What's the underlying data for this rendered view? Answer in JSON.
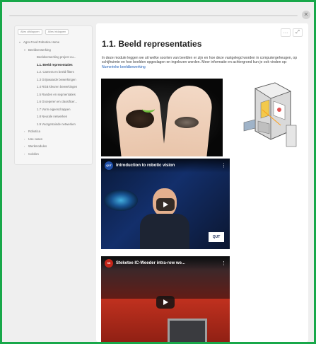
{
  "topbar": {
    "close_icon": "x-icon"
  },
  "sidebar": {
    "actions": [
      "Alles uitklappen",
      "Alles inklappen"
    ],
    "items": [
      {
        "label": "Agro-Food Robotica Home",
        "level": 0,
        "chevron": "▾"
      },
      {
        "label": "Beeldverwerking",
        "level": 1,
        "chevron": "▾"
      },
      {
        "label": "Beeldverwerking project ou...",
        "level": 2,
        "chevron": ""
      },
      {
        "label": "1.1. Beeld representaties",
        "level": 2,
        "chevron": "",
        "active": true
      },
      {
        "label": "1.2. Camera en beeld filters",
        "level": 2,
        "chevron": ""
      },
      {
        "label": "1.3 Grijswaarde bewerkingen",
        "level": 2,
        "chevron": ""
      },
      {
        "label": "1.4 RGB kleuren bewerkingen",
        "level": 2,
        "chevron": ""
      },
      {
        "label": "1.5 Randen en segmentaties",
        "level": 2,
        "chevron": ""
      },
      {
        "label": "1.6 Groeperen en classificer...",
        "level": 2,
        "chevron": ""
      },
      {
        "label": "1.7 Vorm eigenschappen",
        "level": 2,
        "chevron": ""
      },
      {
        "label": "1.8 Neurale netwerken",
        "level": 2,
        "chevron": ""
      },
      {
        "label": "1.9 Voorgetrainde netwerken",
        "level": 2,
        "chevron": ""
      },
      {
        "label": "Robotica",
        "level": 1,
        "chevron": "›"
      },
      {
        "label": "Use cases",
        "level": 1,
        "chevron": "›"
      },
      {
        "label": "Werkmodules",
        "level": 1,
        "chevron": "›"
      },
      {
        "label": "Colofon",
        "level": 1,
        "chevron": "›"
      }
    ]
  },
  "content": {
    "corner_buttons": [
      "…",
      "⤢"
    ],
    "title": "1.1. Beeld representaties",
    "intro_text": "In deze module leggen we uit welke soorten van beelden er zijn en hoe deze vastgelegd worden in computergeheugen, op schijfruimte en hoe beelden opgeslagen en ingelezen worden. Meer informatie en achtergrond kun je ook vinden op: ",
    "intro_link": "Numerieke beeldbewerking",
    "video1": {
      "logo": "QUT",
      "title": "Introduction to robotic vision",
      "menu": "⋮",
      "brand": "QUT"
    },
    "video2": {
      "logo": "SK",
      "title": "Steketee IC-Weeder intra-row we...",
      "menu": "⋮"
    }
  }
}
